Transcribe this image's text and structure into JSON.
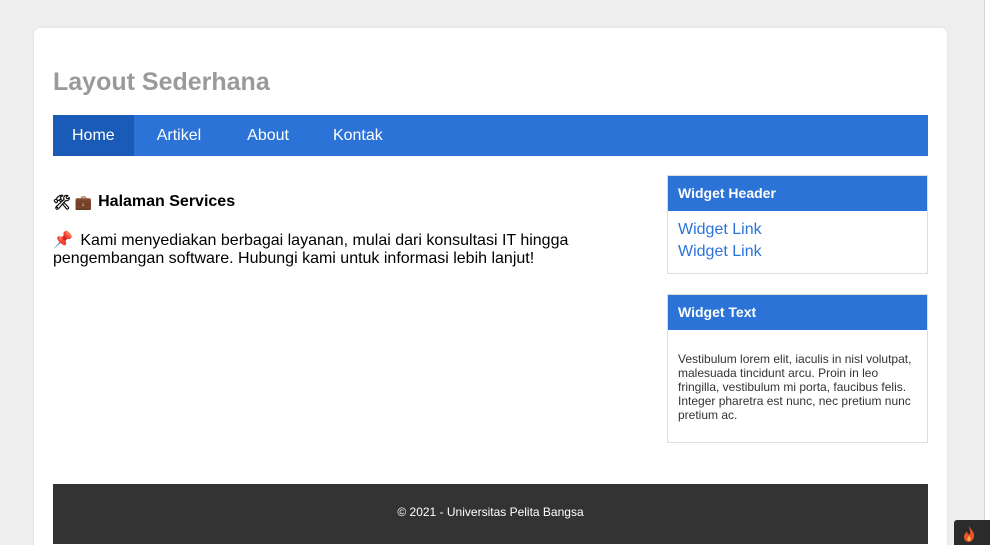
{
  "site": {
    "title": "Layout Sederhana"
  },
  "nav": {
    "items": [
      {
        "label": "Home"
      },
      {
        "label": "Artikel"
      },
      {
        "label": "About"
      },
      {
        "label": "Kontak"
      }
    ]
  },
  "main": {
    "heading_icons": "🛠 💼",
    "heading": "Halaman Services",
    "pin_icon": "📌",
    "paragraph": "Kami menyediakan berbagai layanan, mulai dari konsultasi IT hingga pengembangan software. Hubungi kami untuk informasi lebih lanjut!"
  },
  "widgets": {
    "header_widget": {
      "title": "Widget Header",
      "links": [
        "Widget Link",
        "Widget Link"
      ]
    },
    "text_widget": {
      "title": "Widget Text",
      "body": "Vestibulum lorem elit, iaculis in nisl volutpat, malesuada tincidunt arcu. Proin in leo fringilla, vestibulum mi porta, faucibus felis. Integer pharetra est nunc, nec pretium nunc pretium ac."
    }
  },
  "footer": {
    "text": "© 2021 - Universitas Pelita Bangsa"
  },
  "colors": {
    "accent": "#2b73d7",
    "nav_active": "#1b5bb8",
    "title": "#9a9a9a",
    "footer_bg": "#333333"
  },
  "icons": {
    "corner_tab": "flame-icon"
  }
}
